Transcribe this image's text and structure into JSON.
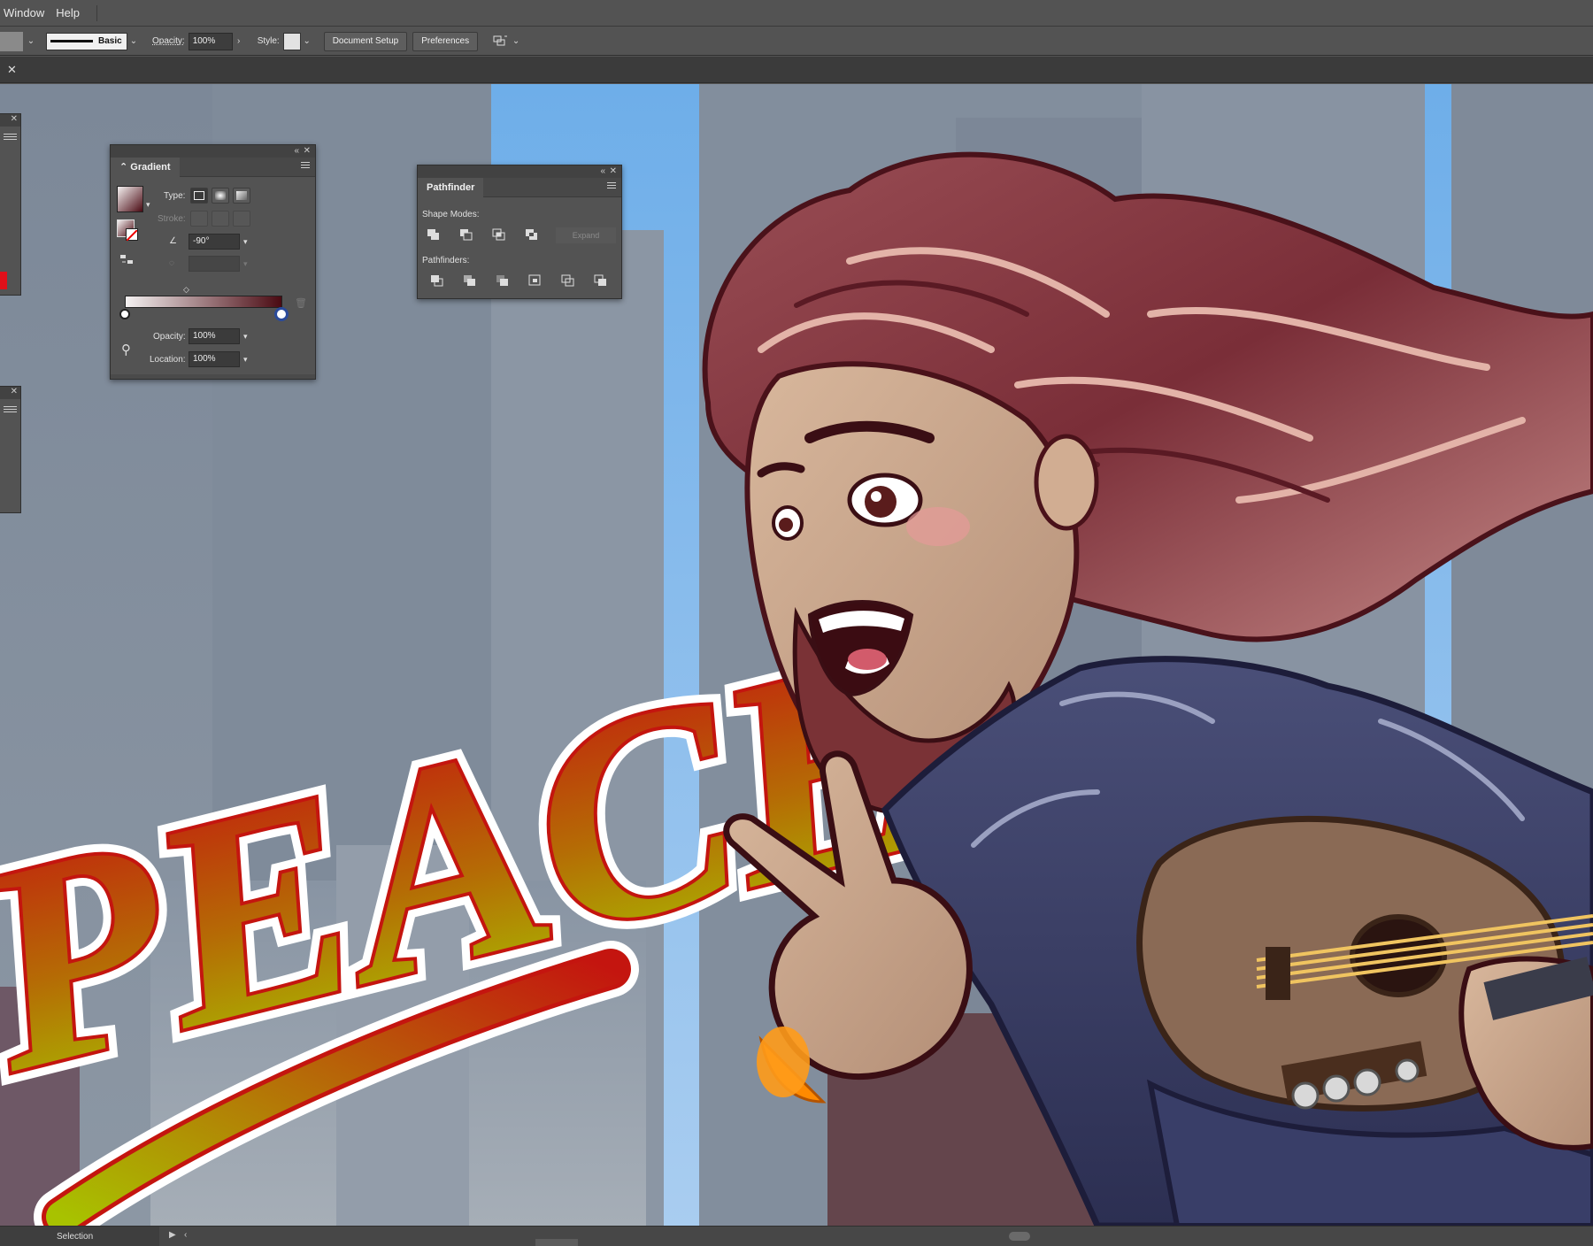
{
  "menubar": {
    "items": [
      "Window",
      "Help"
    ]
  },
  "controlbar": {
    "stroke_style": "Basic",
    "opacity_label": "Opacity:",
    "opacity_value": "100%",
    "style_label": "Style:",
    "document_setup": "Document Setup",
    "preferences": "Preferences"
  },
  "gradient_panel": {
    "title": "Gradient",
    "type_label": "Type:",
    "stroke_label": "Stroke:",
    "angle_value": "-90°",
    "opacity_label": "Opacity:",
    "opacity_value": "100%",
    "location_label": "Location:",
    "location_value": "100%",
    "gradient_start": "#f4f1f1",
    "gradient_end": "#4a0a12"
  },
  "pathfinder_panel": {
    "title": "Pathfinder",
    "shape_modes_label": "Shape Modes:",
    "expand_label": "Expand",
    "pathfinders_label": "Pathfinders:"
  },
  "artwork": {
    "lettering": "PEACE!",
    "sky_color": "#7ab6ec",
    "building_color": "#7b8898",
    "lettering_top": "#c4150f",
    "lettering_bottom": "#a8c200"
  },
  "statusbar": {
    "current_tool": "Selection"
  }
}
